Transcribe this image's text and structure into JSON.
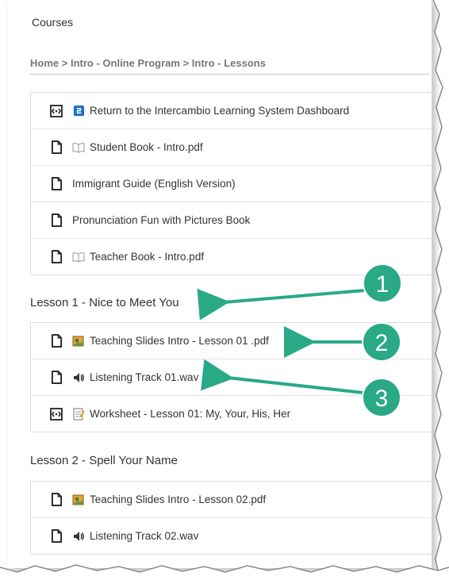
{
  "header": {
    "title": "Courses"
  },
  "breadcrumb": {
    "items": [
      "Home",
      "Intro - Online Program",
      "Intro - Lessons"
    ],
    "separator": ">"
  },
  "top_list": [
    {
      "icon": "external-tool-icon",
      "sub_icon": "dashboard-logo-icon",
      "label": "Return to the Intercambio Learning System Dashboard"
    },
    {
      "icon": "file-icon",
      "sub_icon": "book-icon",
      "label": "Student Book - Intro.pdf"
    },
    {
      "icon": "file-icon",
      "sub_icon": "",
      "label": "Immigrant Guide (English Version)"
    },
    {
      "icon": "file-icon",
      "sub_icon": "",
      "label": "Pronunciation Fun with Pictures Book"
    },
    {
      "icon": "file-icon",
      "sub_icon": "book-icon",
      "label": "Teacher Book - Intro.pdf"
    }
  ],
  "lesson1": {
    "title": "Lesson 1 - Nice to Meet You",
    "items": [
      {
        "icon": "file-icon",
        "sub_icon": "slides-icon",
        "label": "Teaching Slides Intro - Lesson 01 .pdf"
      },
      {
        "icon": "file-icon",
        "sub_icon": "speaker-icon",
        "label": "Listening Track 01.wav"
      },
      {
        "icon": "external-tool-icon",
        "sub_icon": "worksheet-icon",
        "label": "Worksheet - Lesson 01: My, Your, His, Her"
      }
    ]
  },
  "lesson2": {
    "title": "Lesson 2 - Spell Your Name",
    "items": [
      {
        "icon": "file-icon",
        "sub_icon": "slides-icon",
        "label": "Teaching Slides Intro - Lesson 02.pdf"
      },
      {
        "icon": "file-icon",
        "sub_icon": "speaker-icon",
        "label": "Listening Track 02.wav"
      }
    ]
  },
  "callouts": [
    {
      "number": "1"
    },
    {
      "number": "2"
    },
    {
      "number": "3"
    }
  ],
  "colors": {
    "callout": "#2aa987",
    "text": "#333333",
    "breadcrumb": "#777777"
  }
}
